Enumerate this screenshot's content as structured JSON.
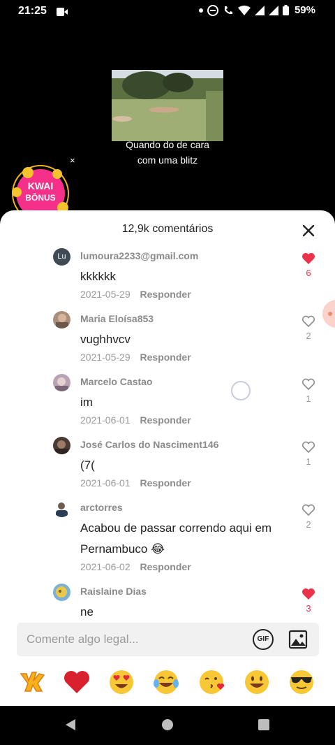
{
  "status": {
    "time": "21:25",
    "battery": "59%"
  },
  "video": {
    "caption_line1": "Quando do de cara",
    "caption_line2": "com uma blitz",
    "close_glyph": "×"
  },
  "kwai_bonus": {
    "line1": "KWAI",
    "line2": "BÔNUS"
  },
  "sheet": {
    "title": "12,9k comentários"
  },
  "reply_label": "Responder",
  "comments": [
    {
      "username": "lumoura2233@gmail.com",
      "avatar_initials": "Lu",
      "text": "kkkkkk",
      "date": "2021-05-29",
      "likes": "6",
      "liked": true
    },
    {
      "username": "Maria Eloísa853",
      "text": "vughhvcv",
      "date": "2021-05-29",
      "likes": "2",
      "liked": false
    },
    {
      "username": "Marcelo Castao",
      "text": "im",
      "date": "2021-06-01",
      "likes": "1",
      "liked": false
    },
    {
      "username": "José Carlos do Nasciment146",
      "text": "(7(",
      "date": "2021-06-01",
      "likes": "1",
      "liked": false
    },
    {
      "username": "arctorres",
      "text": "Acabou de passar correndo aqui em Pernambuco 😂",
      "date": "2021-06-02",
      "likes": "2",
      "liked": false
    },
    {
      "username": "Raislaine Dias",
      "text": "ne",
      "date": "",
      "likes": "3",
      "liked": true
    }
  ],
  "input": {
    "placeholder": "Comente algo legal...",
    "gif_label": "GIF"
  },
  "emojis": [
    "kwai-sticker",
    "red-heart",
    "heart-eyes",
    "tears-of-joy",
    "kissing-heart",
    "grinning",
    "sunglasses"
  ],
  "colors": {
    "accent_like": "#e8334a",
    "sheet_bg": "#ffffff",
    "input_bg": "#f1f1f2"
  }
}
